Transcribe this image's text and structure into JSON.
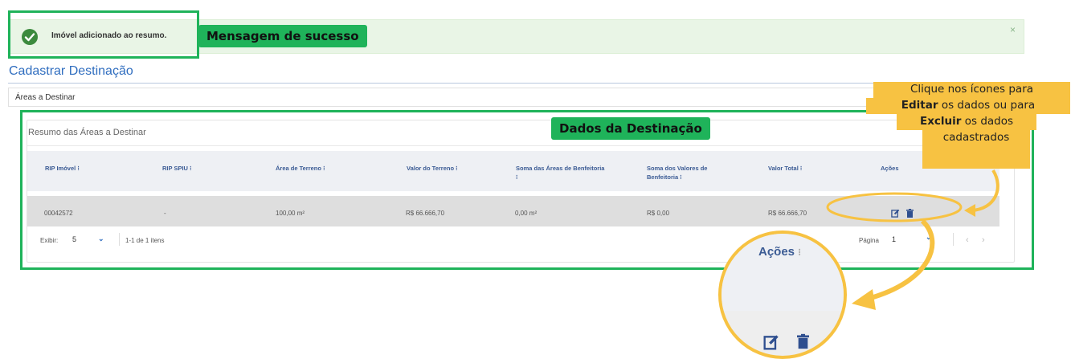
{
  "alert": {
    "message": "Imóvel adicionado ao resumo.",
    "close": "×",
    "check_icon": "check-circle-icon"
  },
  "annotations": {
    "success_label": "Mensagem de sucesso",
    "data_label": "Dados da Destinação",
    "actions_hint_line1": "Clique nos ícones para",
    "actions_hint_edit": "Editar",
    "actions_hint_mid": " os dados ou para",
    "actions_hint_delete": "Excluir",
    "actions_hint_end": " os dados",
    "actions_hint_line4": "cadastrados",
    "highlight_color": "#1fb35a",
    "callout_color": "#f7c242"
  },
  "page": {
    "title": "Cadastrar Destinação",
    "section": "Áreas a Destinar",
    "card_title": "Resumo das Áreas a Destinar"
  },
  "table": {
    "headers": [
      "RIP Imóvel",
      "RIP SPIU",
      "Área de Terreno",
      "Valor do Terreno",
      "Soma das Áreas de Benfeitoria",
      "Soma dos Valores de Benfeitoria",
      "Valor Total",
      "Ações"
    ],
    "sort_glyph": "⁝",
    "rows": [
      {
        "rip_imovel": "00042572",
        "rip_spiu": "-",
        "area_terreno": "100,00 m²",
        "valor_terreno": "R$ 66.666,70",
        "soma_areas_benfeitoria": "0,00 m²",
        "soma_valores_benfeitoria": "R$ 0,00",
        "valor_total": "R$ 66.666,70"
      }
    ]
  },
  "footer": {
    "show_label": "Exibir:",
    "page_size": "5",
    "items_info": "1-1 de 1 itens",
    "page_label": "Página",
    "page_number": "1",
    "prev": "‹",
    "next": "›"
  },
  "zoom": {
    "label": "Ações"
  }
}
